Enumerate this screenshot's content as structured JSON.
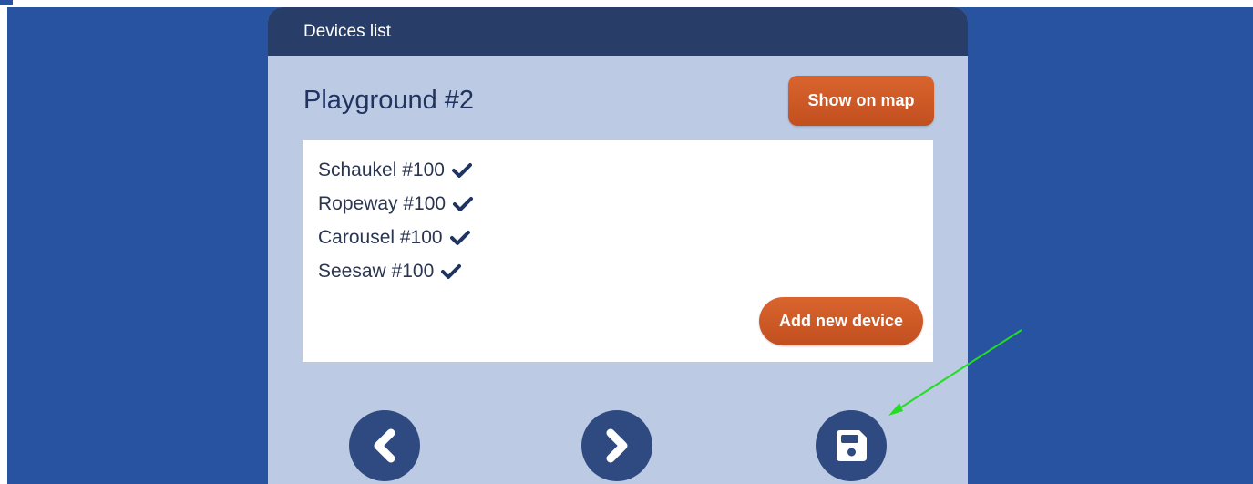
{
  "panel": {
    "header_title": "Devices list",
    "page_title": "Playground #2",
    "show_on_map_label": "Show on map",
    "add_device_label": "Add new device"
  },
  "devices": [
    {
      "label": "Schaukel #100",
      "status_icon": "check-icon"
    },
    {
      "label": "Ropeway #100",
      "status_icon": "check-icon"
    },
    {
      "label": "Carousel #100",
      "status_icon": "check-icon"
    },
    {
      "label": "Seesaw #100",
      "status_icon": "check-icon"
    }
  ],
  "navigation": {
    "prev_icon": "chevron-left-icon",
    "next_icon": "chevron-right-icon",
    "save_icon": "floppy-disk-icon"
  },
  "colors": {
    "background": "#2753a1",
    "panel": "#bccae3",
    "header": "#283e69",
    "accent_orange": "#d05a28",
    "nav_button": "#2e4a80",
    "annotation_arrow": "#22dd22"
  }
}
